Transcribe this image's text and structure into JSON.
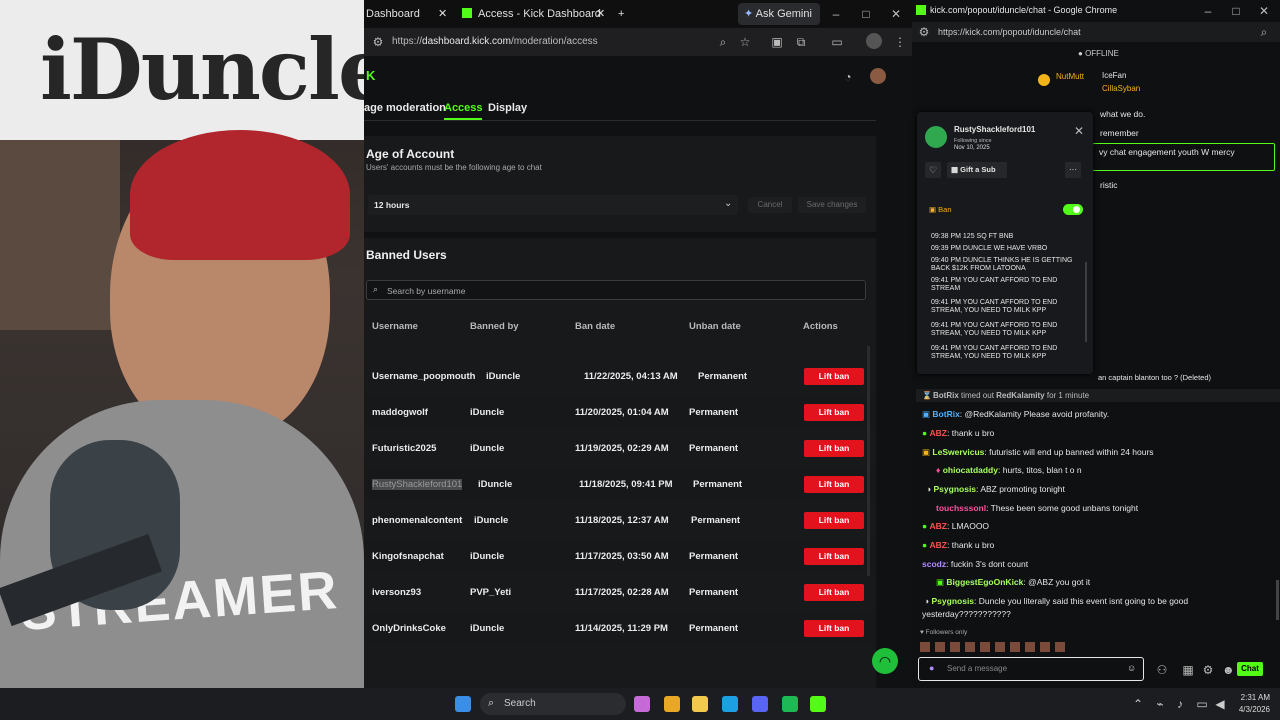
{
  "webcam": {
    "poster_text": "iDuncle",
    "hoodie_text": "STREAMER"
  },
  "left_browser": {
    "tabs": [
      {
        "label": "Dashboard"
      },
      {
        "label": "Access - Kick Dashboard"
      }
    ],
    "new_tab": "+",
    "ask_gemini": "Ask Gemini",
    "url_prefix": "https://",
    "url_host": "dashboard.kick.com",
    "url_path": "/moderation/access",
    "nav": [
      "age moderation",
      "Access",
      "Display"
    ],
    "age_title": "Age of Account",
    "age_sub": "Users' accounts must be the following age to chat",
    "age_value": "12 hours",
    "cancel_label": "Cancel",
    "save_label": "Save changes",
    "banned_title": "Banned Users",
    "search_placeholder": "Search by username",
    "columns": [
      "Username",
      "Banned by",
      "Ban date",
      "Unban date",
      "Actions"
    ],
    "rows": [
      {
        "username": "Username_poopmouth",
        "by": "iDuncle",
        "date": "11/22/2025, 04:13 AM",
        "unban": "Permanent",
        "action": "Lift ban"
      },
      {
        "username": "maddogwolf",
        "by": "iDuncle",
        "date": "11/20/2025, 01:04 AM",
        "unban": "Permanent",
        "action": "Lift ban"
      },
      {
        "username": "Futuristic2025",
        "by": "iDuncle",
        "date": "11/19/2025, 02:29 AM",
        "unban": "Permanent",
        "action": "Lift ban"
      },
      {
        "username": "RustyShackleford101",
        "by": "iDuncle",
        "date": "11/18/2025, 09:41 PM",
        "unban": "Permanent",
        "action": "Lift ban"
      },
      {
        "username": "phenomenalcontent",
        "by": "iDuncle",
        "date": "11/18/2025, 12:37 AM",
        "unban": "Permanent",
        "action": "Lift ban"
      },
      {
        "username": "Kingofsnapchat",
        "by": "iDuncle",
        "date": "11/17/2025, 03:50 AM",
        "unban": "Permanent",
        "action": "Lift ban"
      },
      {
        "username": "iversonz93",
        "by": "PVP_Yeti",
        "date": "11/17/2025, 02:28 AM",
        "unban": "Permanent",
        "action": "Lift ban"
      },
      {
        "username": "OnlyDrinksCoke",
        "by": "iDuncle",
        "date": "11/14/2025, 11:29 PM",
        "unban": "Permanent",
        "action": "Lift ban"
      }
    ]
  },
  "right_browser": {
    "title": "kick.com/popout/iduncle/chat - Google Chrome",
    "url": "https://kick.com/popout/iduncle/chat",
    "offline": "OFFLINE",
    "top_users": [
      "NutMutt",
      "IceFan",
      "CillaSyban"
    ],
    "partial_lines": [
      "what we do.",
      "remember",
      "vy chat engagement youth W mercy",
      "ristic"
    ],
    "popup": {
      "username": "RustyShackleford101",
      "following_label": "Following since",
      "following_date": "Nov 10, 2025",
      "gift_label": "Gift a Sub",
      "ban_label": "Ban",
      "log": [
        "09:38 PM 125 SQ FT BNB",
        "09:39 PM DUNCLE WE HAVE VRBO",
        "09:40 PM DUNCLE THINKS HE IS GETTING BACK $12K FROM LATOONA",
        "09:41 PM YOU CANT AFFORD TO END STREAM",
        "09:41 PM YOU CANT AFFORD TO END STREAM, YOU NEED TO MILK KPP",
        "09:41 PM YOU CANT AFFORD TO END STREAM, YOU NEED TO MILK KPP",
        "09:41 PM YOU CANT AFFORD TO END STREAM, YOU NEED TO MILK KPP"
      ]
    },
    "deleted_line": "an captain blanton too ? (Deleted)",
    "timeout": {
      "user": "BotRix",
      "text": "timed out",
      "target": "RedKalamity",
      "duration": "for 1 minute"
    },
    "messages": [
      {
        "user": "BotRix",
        "color": "#4fb0ff",
        "text": "@RedKalamity Please avoid profanity."
      },
      {
        "user": "ABZ",
        "color": "#ff4f4f",
        "text": "thank u bro"
      },
      {
        "user": "LeSwervicus",
        "color": "#a7ff5c",
        "text": "futuristic will end up banned within 24 hours"
      },
      {
        "user": "ohiocatdaddy",
        "color": "#a7ff5c",
        "text": "hurts, titos, blan t o n"
      },
      {
        "user": "Psygnosis",
        "color": "#a7ff5c",
        "text": "ABZ promoting tonight"
      },
      {
        "user": "touchsssonl",
        "color": "#ff4fa0",
        "text": "These been some good unbans tonight"
      },
      {
        "user": "ABZ",
        "color": "#ff4f4f",
        "text": "LMAOOO"
      },
      {
        "user": "ABZ",
        "color": "#ff4f4f",
        "text": "thank u bro"
      },
      {
        "user": "scodz",
        "color": "#b18cff",
        "text": "fuckin 3's dont count"
      },
      {
        "user": "BiggestEgoOnKick",
        "color": "#a7ff5c",
        "text": "@ABZ you got it"
      },
      {
        "user": "Psygnosis",
        "color": "#a7ff5c",
        "text": "Duncle you literally said this event isnt going to be good"
      },
      {
        "user": "",
        "color": "#e6e6e6",
        "text": "yesterday???????????"
      }
    ],
    "followers_only": "Followers only",
    "input_placeholder": "Send a message",
    "chat_button": "Chat"
  },
  "taskbar": {
    "search": "Search",
    "time": "2:31 AM",
    "date": "4/3/2026"
  }
}
